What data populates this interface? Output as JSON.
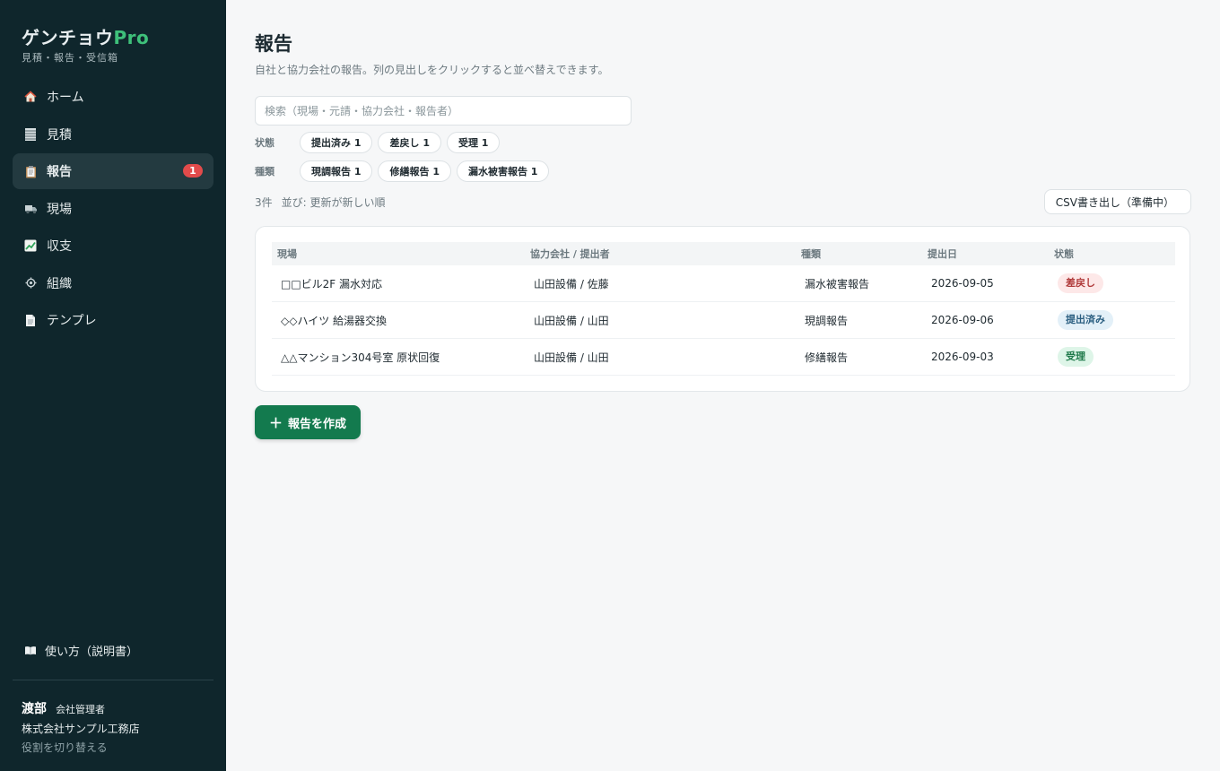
{
  "colors": {
    "sidebar_bg": "#0f262c",
    "accent": "#137a4e",
    "brand_pro": "#3ec07a",
    "badge": "#e24b4b",
    "status_returned": "#fde8e8",
    "status_submitted": "#e3f0f8",
    "status_accepted": "#def5e8"
  },
  "brand": {
    "name": "ゲンチョウ",
    "pro": "Pro",
    "subtitle": "見積・報告・受信箱"
  },
  "sidebar": {
    "items": [
      {
        "label": "ホーム",
        "icon": "house-icon"
      },
      {
        "label": "見積",
        "icon": "ledger-icon"
      },
      {
        "label": "報告",
        "icon": "clipboard-icon",
        "badge": "1",
        "active": true
      },
      {
        "label": "現場",
        "icon": "truck-icon"
      },
      {
        "label": "収支",
        "icon": "chart-icon"
      },
      {
        "label": "組織",
        "icon": "gear-icon"
      },
      {
        "label": "テンプレ",
        "icon": "document-icon"
      }
    ],
    "help_label": "使い方（説明書）",
    "user": {
      "name": "渡部",
      "role": "会社管理者",
      "company": "株式会社サンプル工務店",
      "switch_label": "役割を切り替える"
    }
  },
  "main": {
    "title": "報告",
    "description": "自社と協力会社の報告。列の見出しをクリックすると並べ替えできます。",
    "search_placeholder": "検索（現場・元請・協力会社・報告者）",
    "filters": {
      "status_label": "状態",
      "status_chips": [
        "提出済み 1",
        "差戻し 1",
        "受理 1"
      ],
      "type_label": "種類",
      "type_chips": [
        "現調報告 1",
        "修繕報告 1",
        "漏水被害報告 1"
      ]
    },
    "count": "3件",
    "sort": "並び: 更新が新しい順",
    "csv_button": "CSV書き出し（準備中）",
    "table": {
      "headers": [
        "現場",
        "協力会社 / 提出者",
        "種類",
        "提出日",
        "状態"
      ],
      "rows": [
        {
          "site": "□□ビル2F 漏水対応",
          "partner": "山田設備 / 佐藤",
          "type": "漏水被害報告",
          "date": "2026-09-05",
          "status": "差戻し"
        },
        {
          "site": "◇◇ハイツ 給湯器交換",
          "partner": "山田設備 / 山田",
          "type": "現調報告",
          "date": "2026-09-06",
          "status": "提出済み"
        },
        {
          "site": "△△マンション304号室 原状回復",
          "partner": "山田設備 / 山田",
          "type": "修繕報告",
          "date": "2026-09-03",
          "status": "受理"
        }
      ]
    },
    "create_button": "報告を作成",
    "create_icon": "plus-icon"
  }
}
